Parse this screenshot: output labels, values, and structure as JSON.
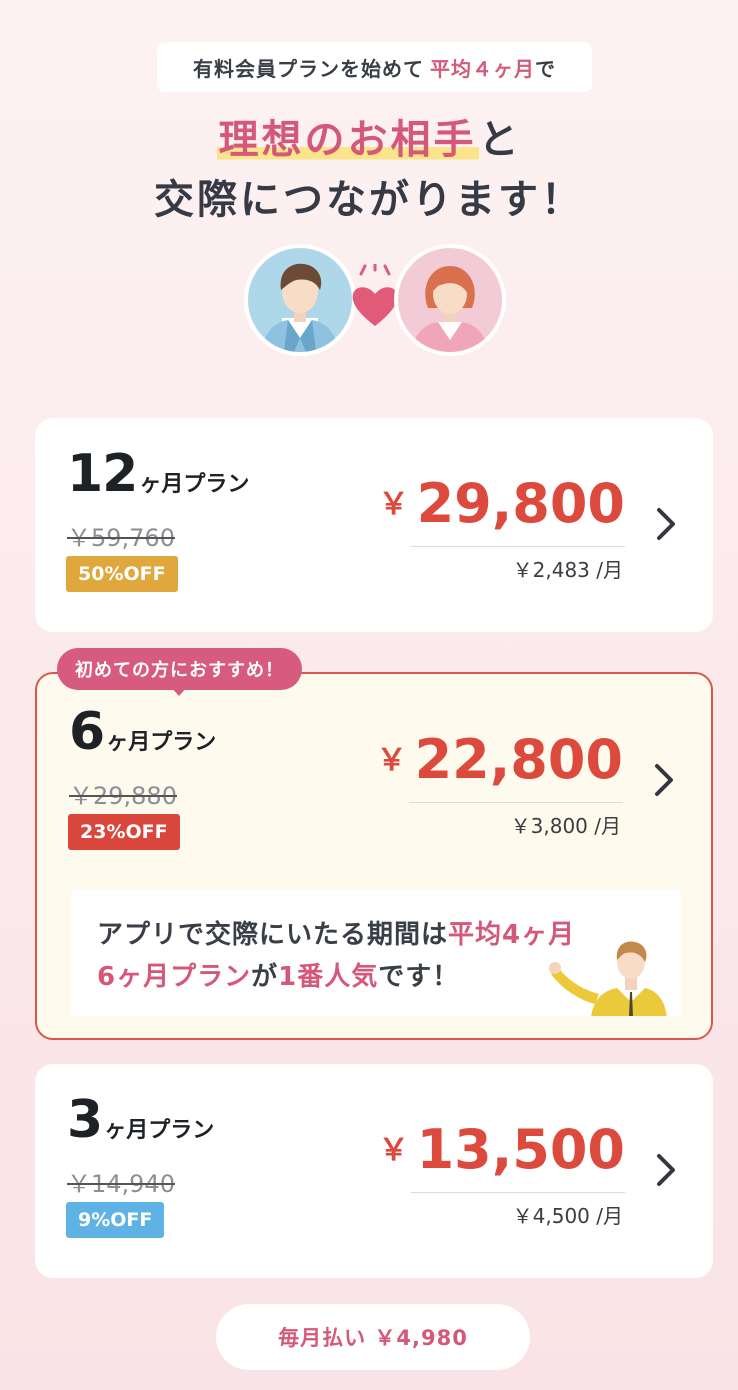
{
  "hero": {
    "pill_text": "有料会員プランを始めて",
    "pill_accent": "平均４ヶ月",
    "pill_suffix": "で",
    "headline_highlight": "理想のお相手",
    "headline_rest1": "と",
    "headline_line2": "交際につながります！"
  },
  "plans": [
    {
      "num": "12",
      "unit": "ヶ月プラン",
      "old_price": "￥59,760",
      "badge": "50%OFF",
      "yen": "￥",
      "price": "29,800",
      "monthly": "￥2,483 /月"
    },
    {
      "num": "6",
      "unit": "ヶ月プラン",
      "old_price": "￥29,880",
      "badge": "23%OFF",
      "yen": "￥",
      "price": "22,800",
      "monthly": "￥3,800 /月",
      "recommend": "初めての方におすすめ！",
      "info_line1_a": "アプリで交際にいたる期間は",
      "info_line1_b": "平均4ヶ月",
      "info_line2_a": "6ヶ月プラン",
      "info_line2_b": "が",
      "info_line2_c": "1番人気",
      "info_line2_d": "です！"
    },
    {
      "num": "3",
      "unit": "ヶ月プラン",
      "old_price": "￥14,940",
      "badge": "9%OFF",
      "yen": "￥",
      "price": "13,500",
      "monthly": "￥4,500 /月"
    }
  ],
  "monthly_plan": {
    "label": "毎月払い ￥4,980"
  },
  "icons": {
    "chevron": "chevron-right-icon",
    "heart": "heart-icon"
  },
  "colors": {
    "accent_pink": "#d4587a",
    "price_red": "#dc4a3e",
    "badge_gold": "#e0a73c",
    "badge_red": "#d8463c",
    "badge_blue": "#5eb3e4"
  }
}
